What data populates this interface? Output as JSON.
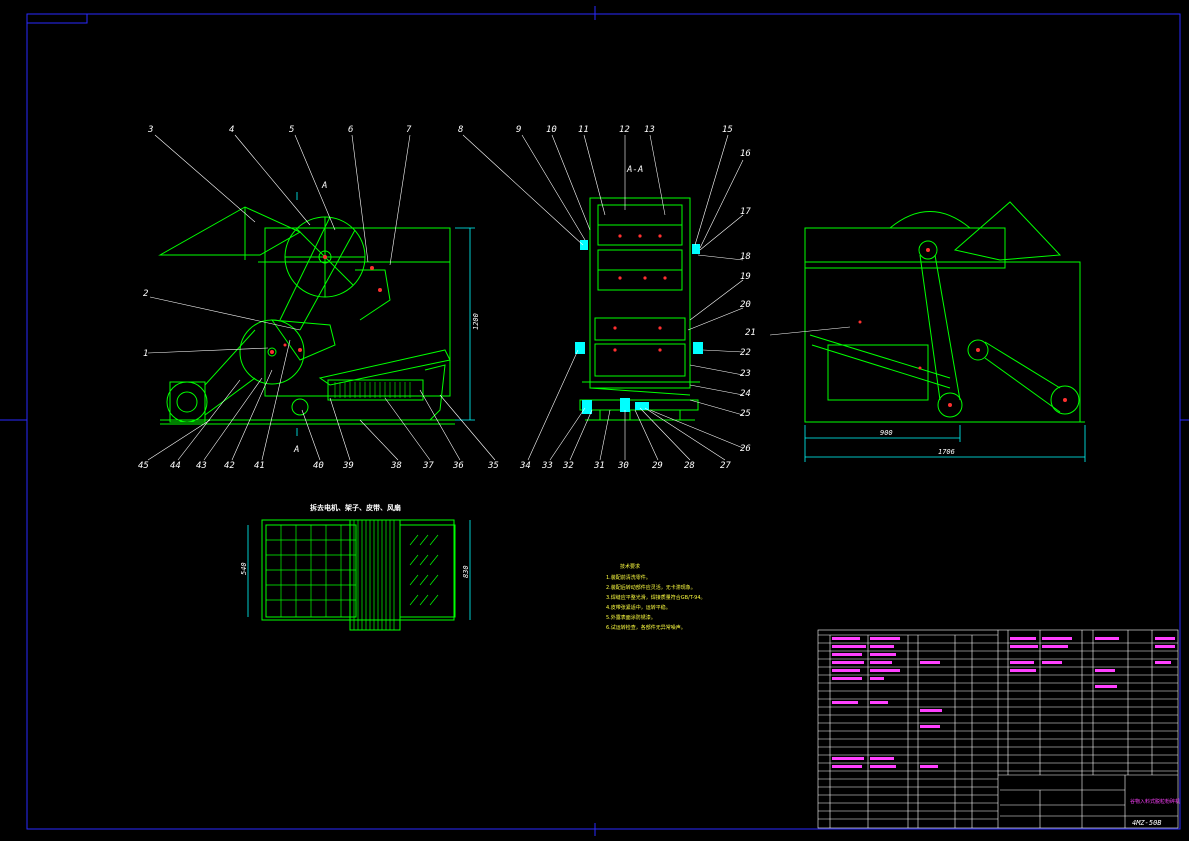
{
  "drawing": {
    "section_label": "A-A",
    "section_marker": "A",
    "dimensions": {
      "height": "1200",
      "width_1": "900",
      "width_2": "1706",
      "plan_height_1": "540",
      "plan_height_2": "830"
    },
    "plan_caption": "拆去电机、架子、皮带、风扇",
    "tech_notes_title": "技术要求",
    "tech_notes": [
      "1.装配前清洗零件。",
      "2.装配后转动部件应灵活，无卡滞现象。",
      "3.焊缝应平整光滑，焊接质量符合GB/T-94。",
      "4.皮带张紧适中，运转平稳。",
      "5.外露表面涂防锈漆。",
      "6.试运转检查，各部件无异常噪声。"
    ],
    "part_numbers_left": [
      "3",
      "4",
      "5",
      "6",
      "7",
      "2",
      "1",
      "45",
      "44",
      "43",
      "42",
      "41",
      "40",
      "39",
      "38",
      "37",
      "36",
      "35"
    ],
    "part_numbers_mid": [
      "8",
      "9",
      "10",
      "11",
      "12",
      "13",
      "15",
      "16",
      "17",
      "18",
      "19",
      "20",
      "21",
      "22",
      "23",
      "24",
      "25",
      "26",
      "34",
      "33",
      "32",
      "31",
      "30",
      "29",
      "28",
      "27"
    ],
    "drawing_number": "4MZ-50B",
    "machine_title": "谷物入料式脱粒粉碎机"
  },
  "colors": {
    "frame": "#1a1aff",
    "geometry": "#00ff00",
    "leader": "#ffffff",
    "table": "#ffffff",
    "table_text": "#ff40ff",
    "notes": "#ffff40",
    "cyan": "#00ffff"
  }
}
